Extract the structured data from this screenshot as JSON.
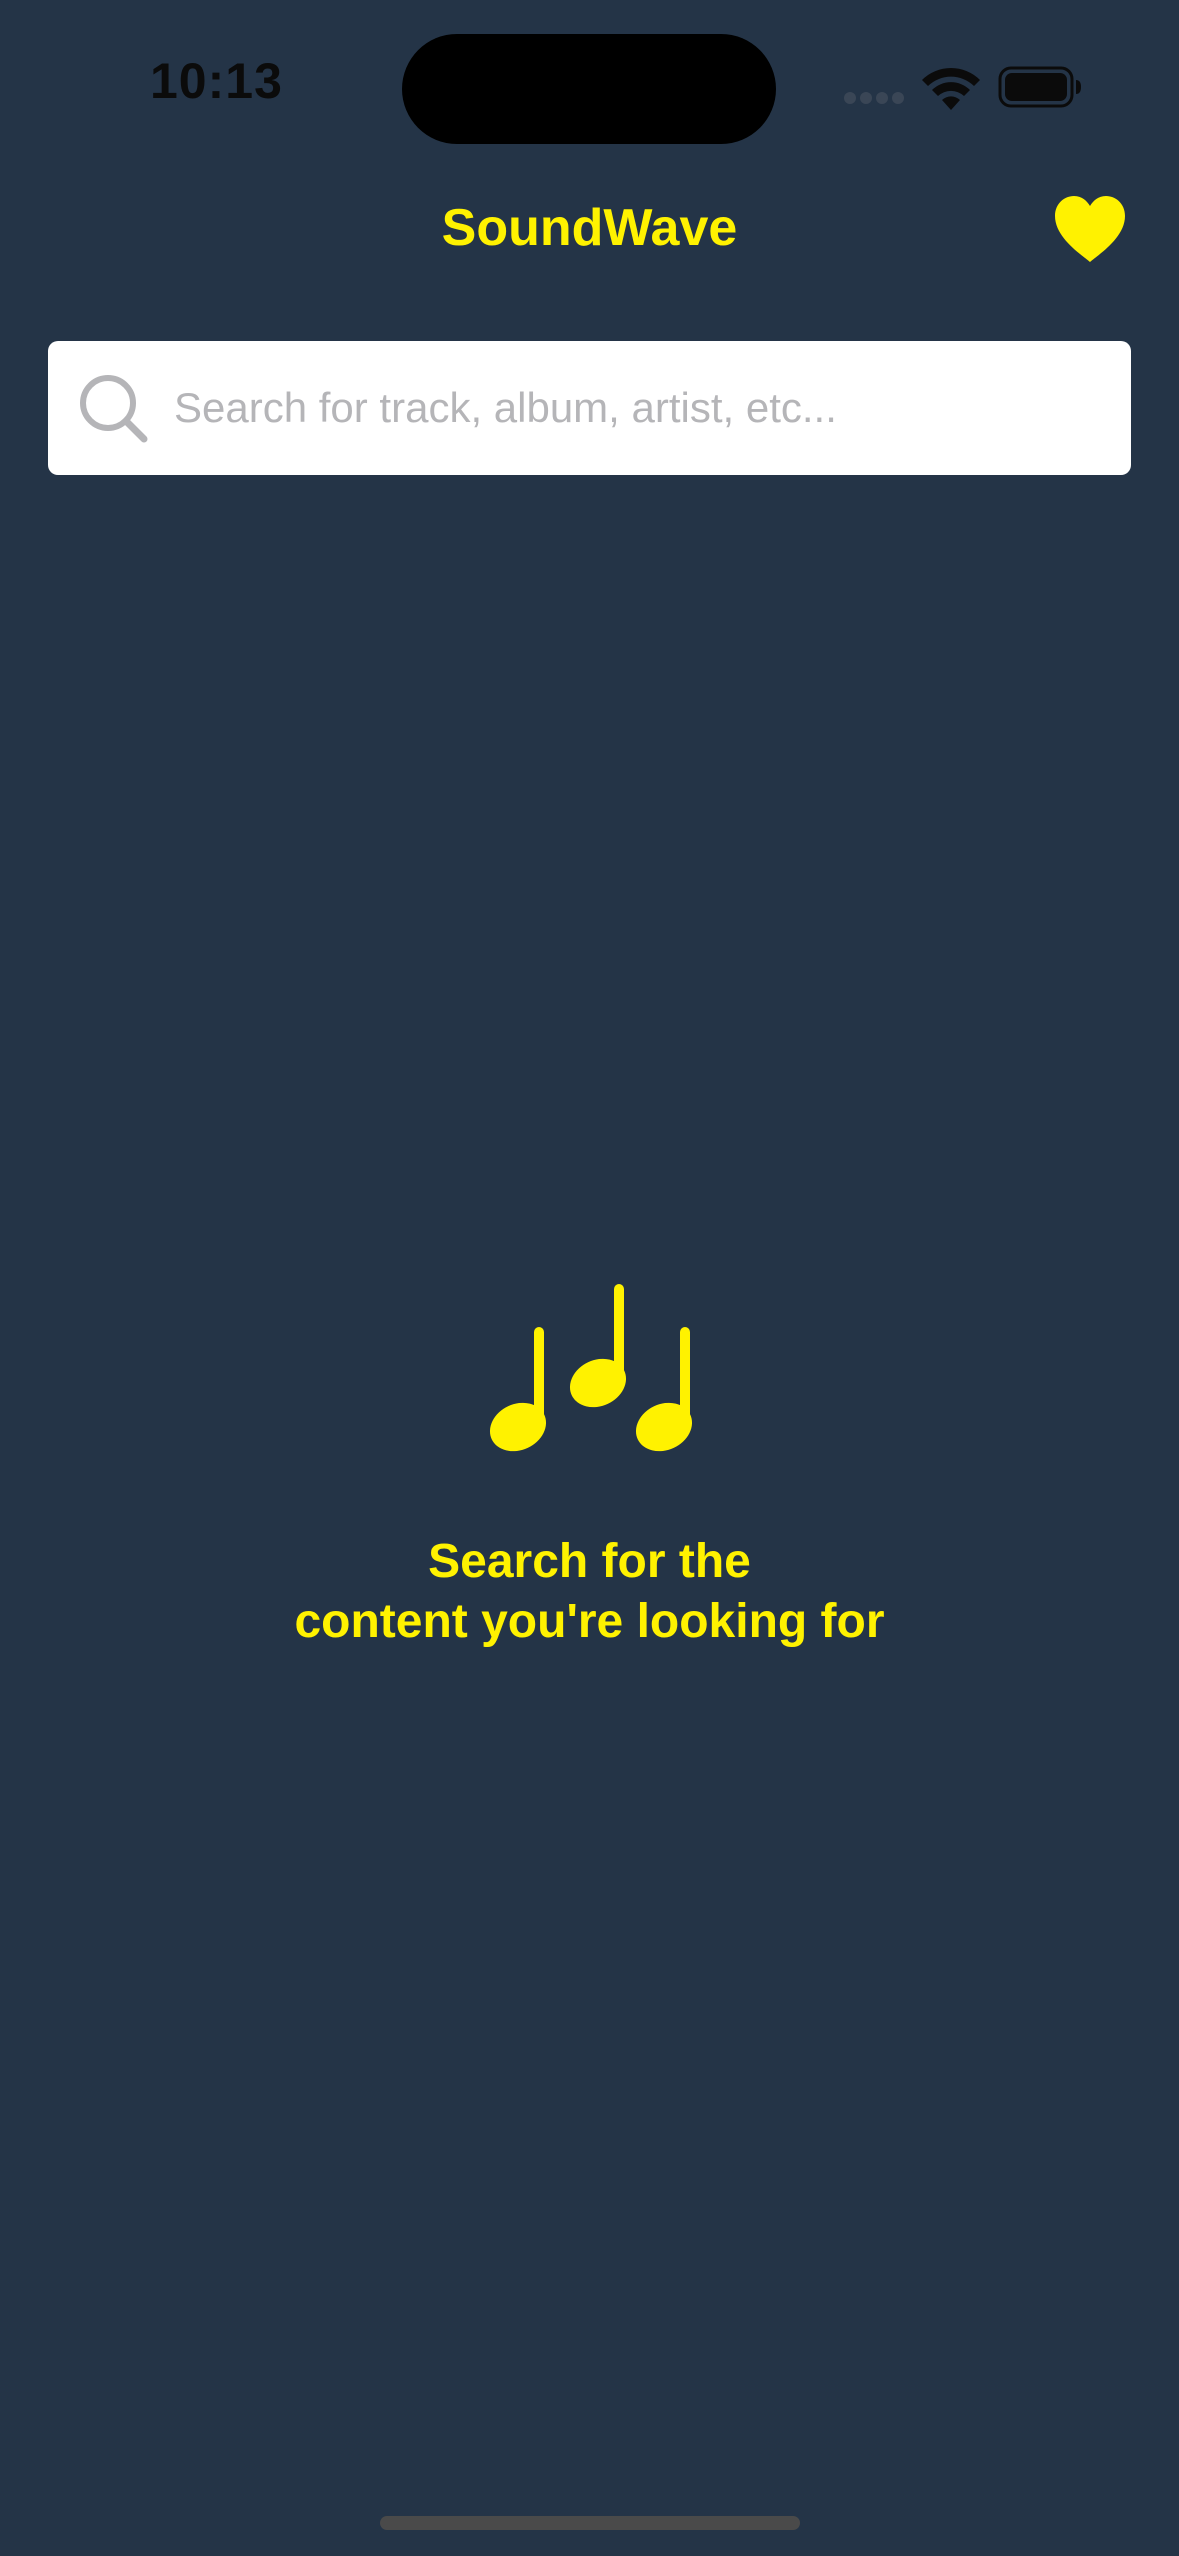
{
  "status_bar": {
    "time": "10:13"
  },
  "header": {
    "title": "SoundWave",
    "favorites_icon": "heart-icon"
  },
  "search": {
    "placeholder": "Search for track, album, artist, etc...",
    "value": "",
    "icon": "search-icon"
  },
  "empty_state": {
    "icon": "music-notes-icon",
    "line1": "Search for the",
    "line2": "content you're looking for"
  },
  "colors": {
    "background": "#243447",
    "accent": "#FFF200",
    "search_field": "#FFFFFF",
    "placeholder": "#B5B5B8"
  }
}
